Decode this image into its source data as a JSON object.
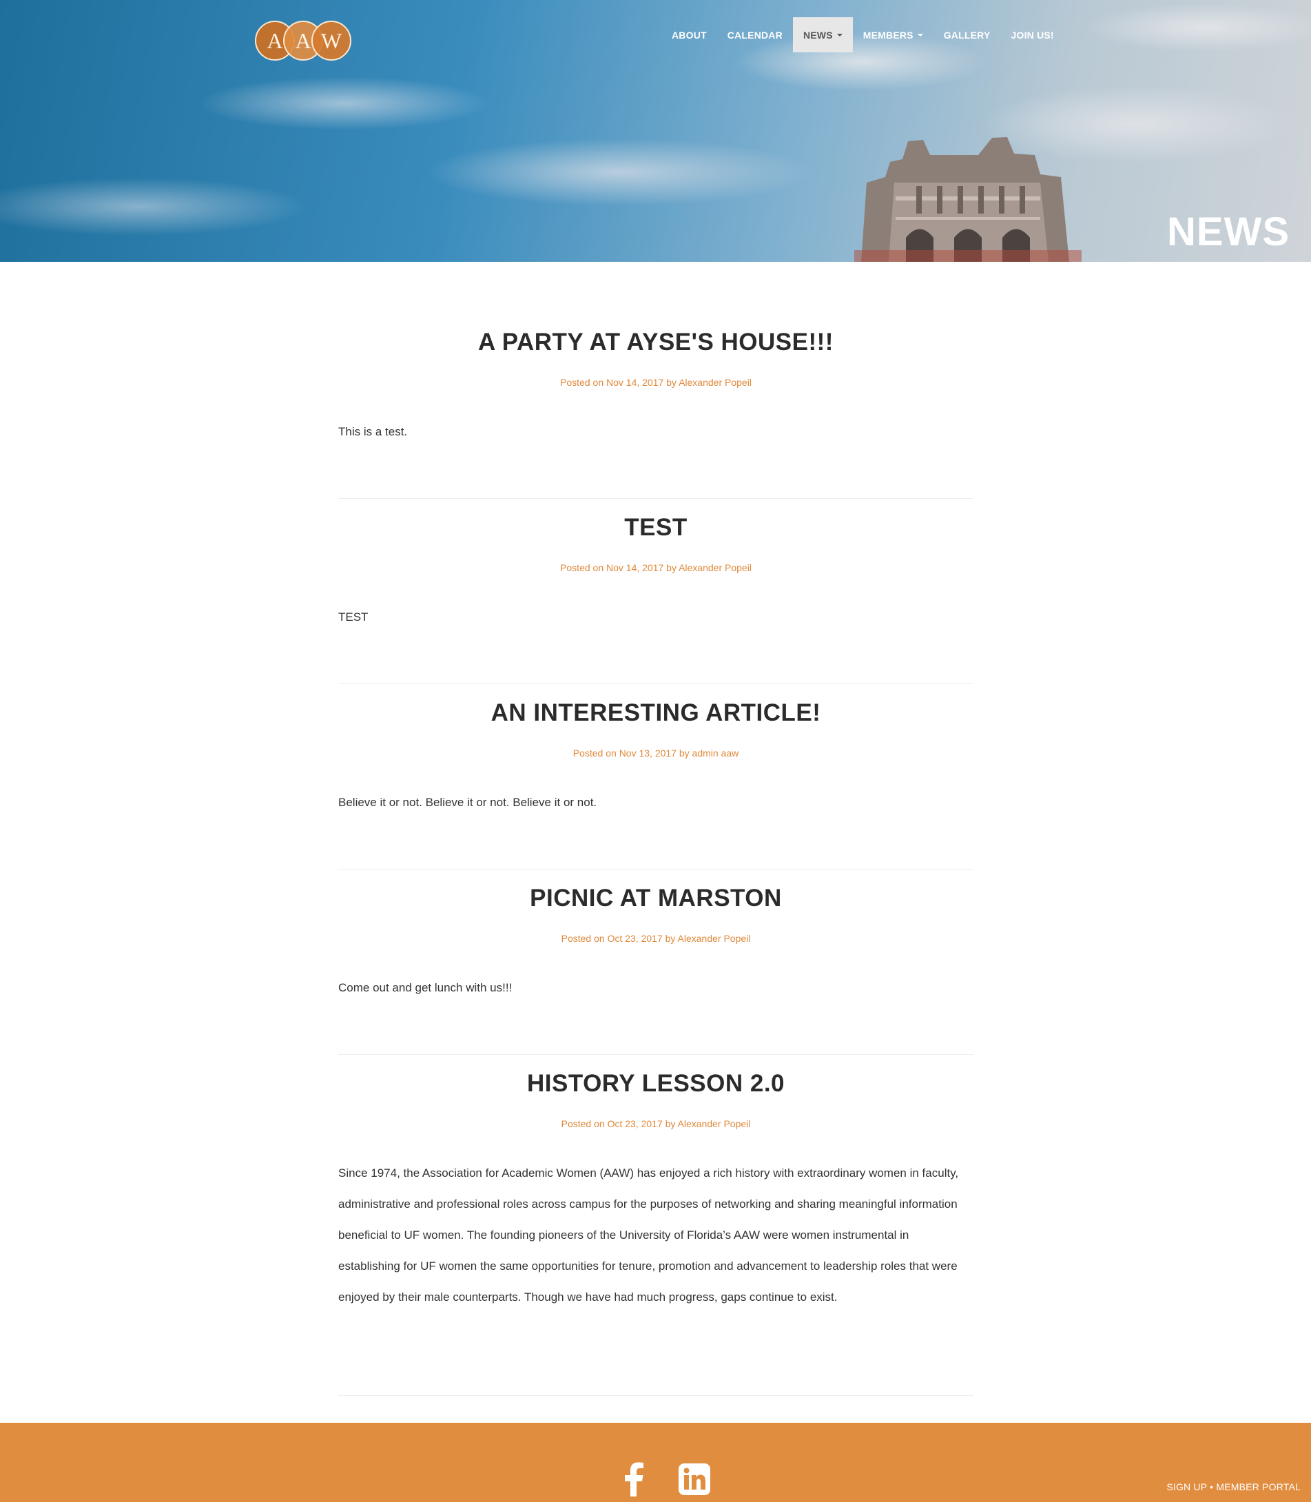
{
  "logo": {
    "letters": [
      "A",
      "A",
      "W"
    ]
  },
  "nav": {
    "items": [
      {
        "label": "ABOUT"
      },
      {
        "label": "CALENDAR"
      },
      {
        "label": "NEWS",
        "dropdown": true,
        "active": true
      },
      {
        "label": "MEMBERS",
        "dropdown": true
      },
      {
        "label": "GALLERY"
      },
      {
        "label": "JOIN US!"
      }
    ]
  },
  "hero": {
    "title": "NEWS"
  },
  "posts": [
    {
      "title": "A PARTY AT AYSE'S HOUSE!!!",
      "meta": "Posted on Nov 14, 2017 by Alexander Popeil",
      "body": "This is a test."
    },
    {
      "title": "TEST",
      "meta": "Posted on Nov 14, 2017 by Alexander Popeil",
      "body": "TEST"
    },
    {
      "title": "AN INTERESTING ARTICLE!",
      "meta": "Posted on Nov 13, 2017 by admin aaw",
      "body": "Believe it or not. Believe it or not. Believe it or not."
    },
    {
      "title": "PICNIC AT MARSTON",
      "meta": "Posted on Oct 23, 2017 by Alexander Popeil",
      "body": "Come out and get lunch with us!!!"
    },
    {
      "title": "HISTORY LESSON 2.0",
      "meta": "Posted on Oct 23, 2017 by Alexander Popeil",
      "body": "Since 1974, the Association for Academic Women (AAW) has enjoyed a rich history with extraordinary women in faculty, administrative and professional roles across campus for the purposes of networking and sharing meaningful information beneficial to UF women. The founding pioneers of the University of Florida’s AAW were women instrumental in establishing for UF women the same opportunities for tenure, promotion and advancement to leadership roles that were enjoyed by their male counterparts. Though we have had much progress, gaps continue to exist."
    }
  ],
  "footer": {
    "social": [
      "facebook-icon",
      "linkedin-icon"
    ],
    "sign_up": "SIGN UP",
    "separator": "•",
    "member_portal": "MEMBER PORTAL"
  },
  "colors": {
    "accent": "#e0883a",
    "footer_bg": "#e18d3f",
    "nav_active_bg": "#e7e7e7"
  }
}
